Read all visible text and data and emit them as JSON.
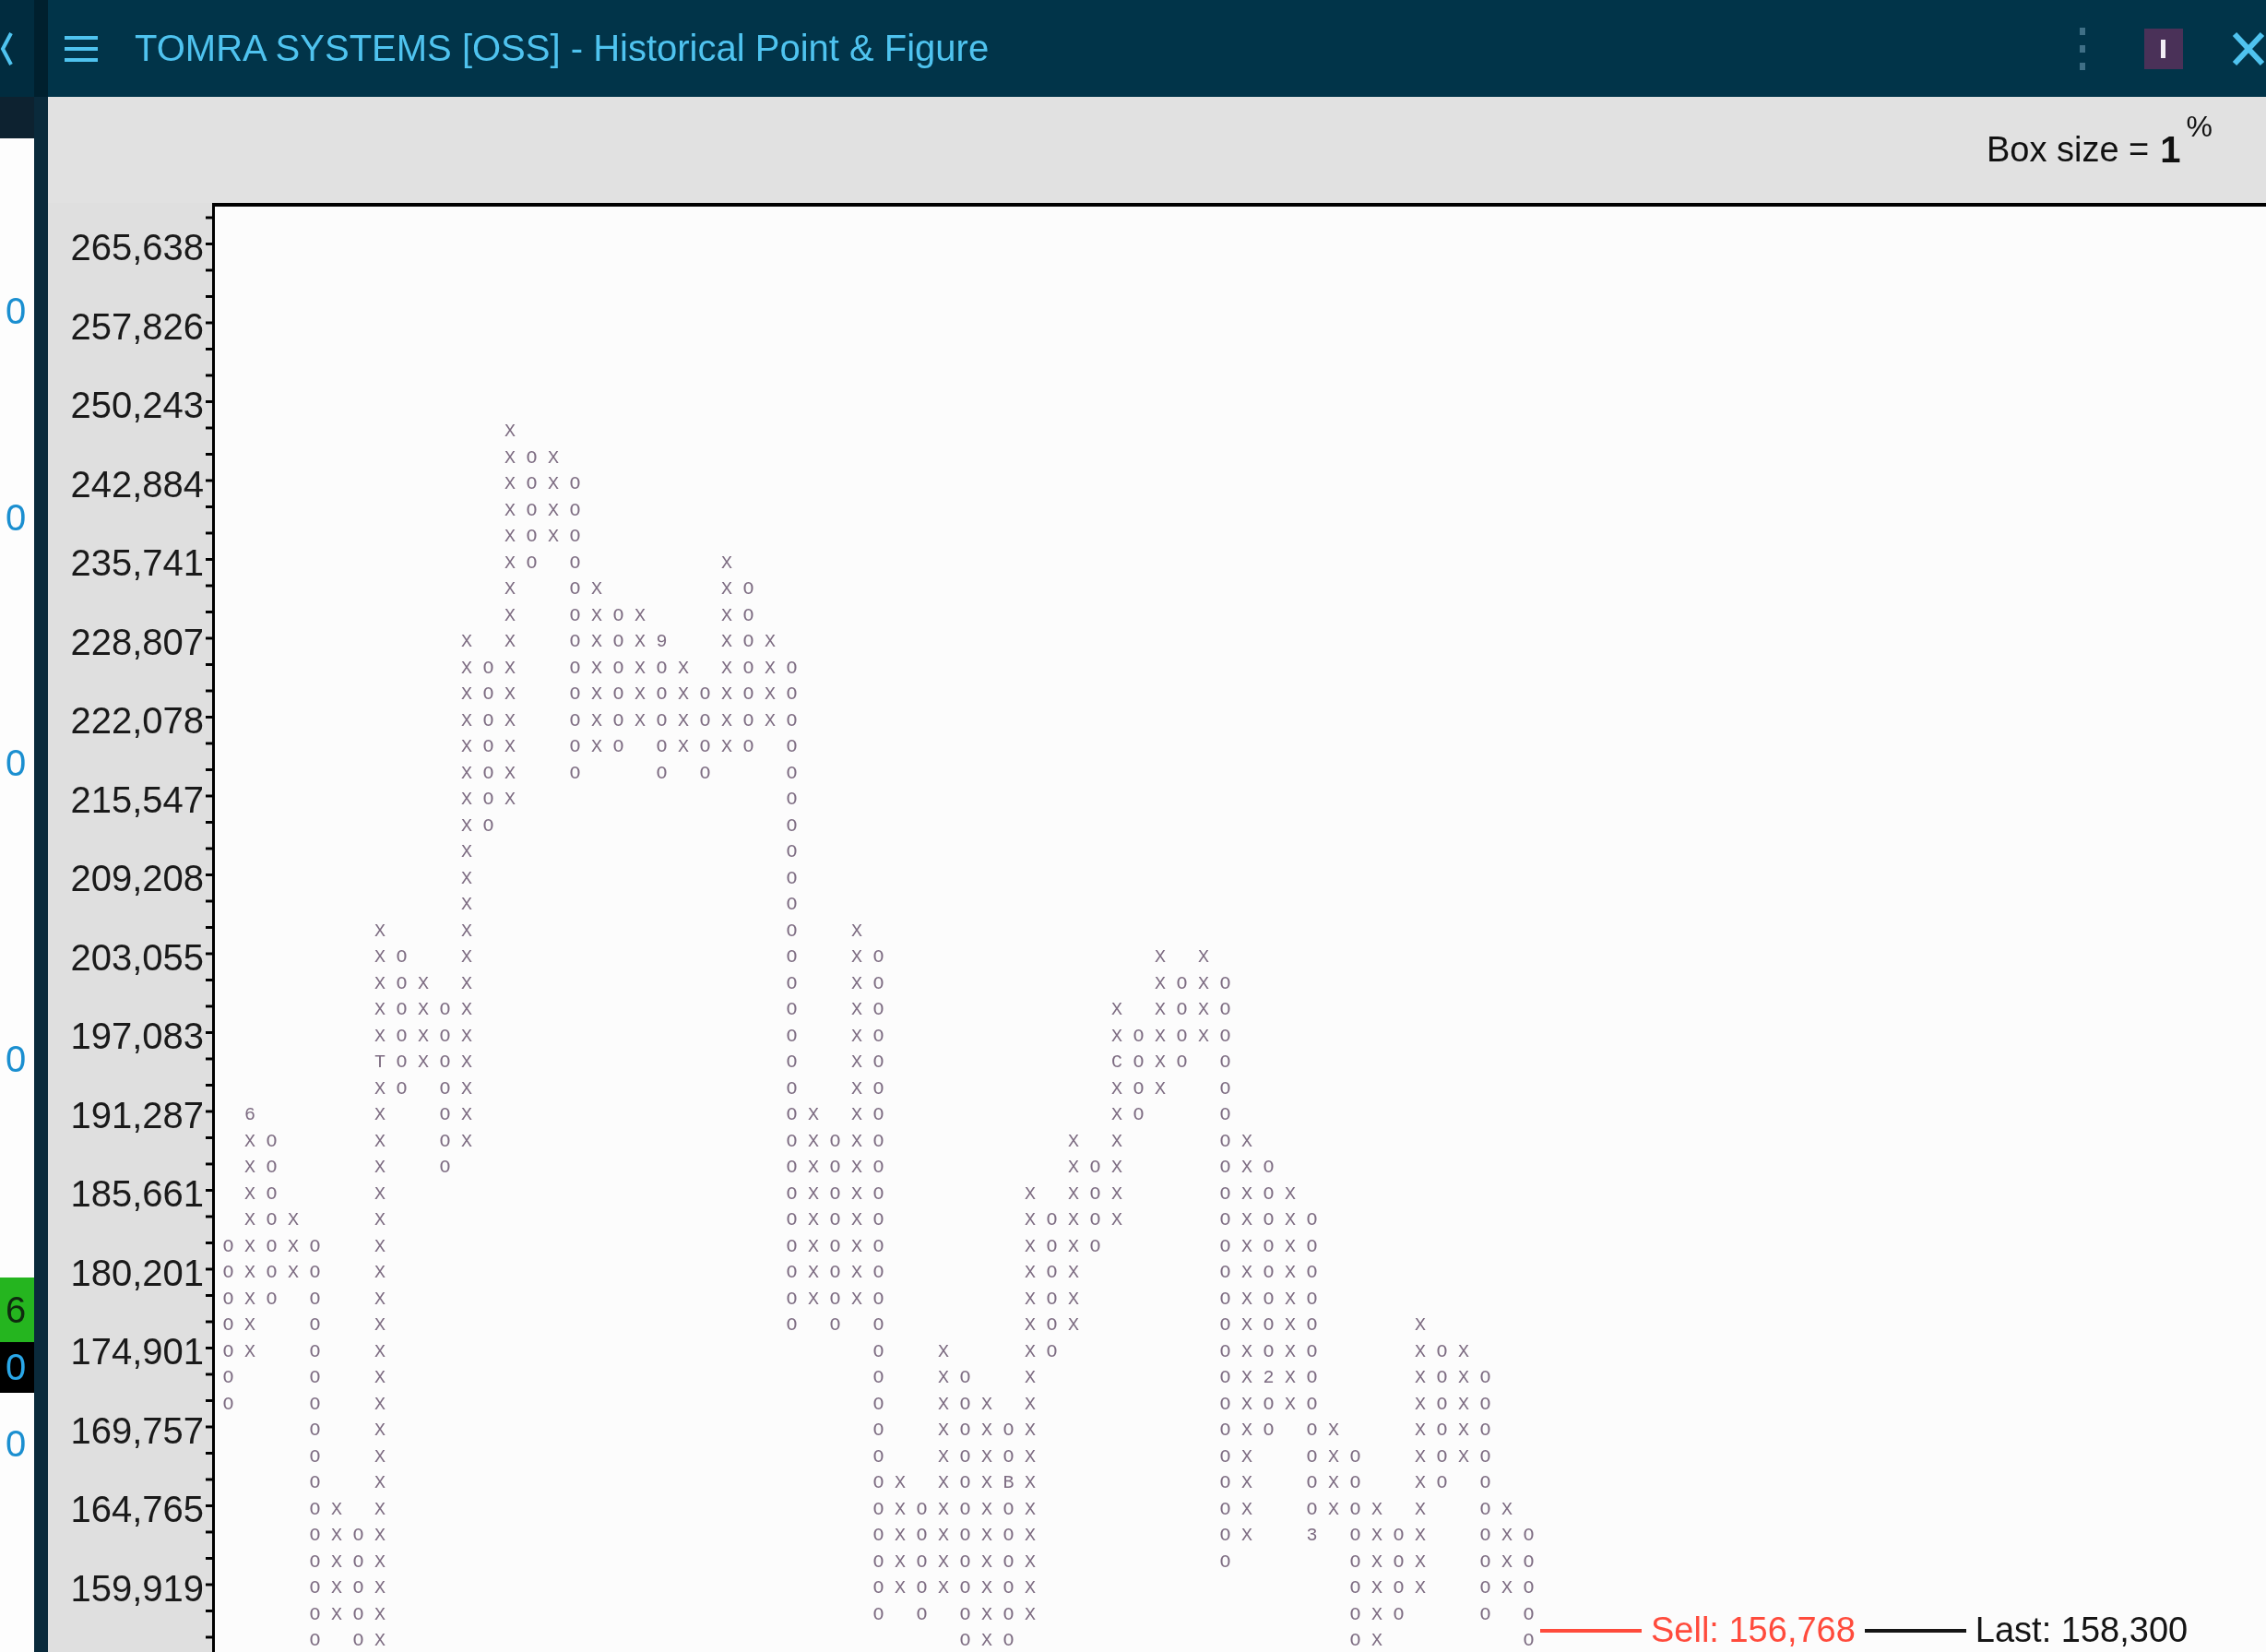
{
  "window": {
    "title": "TOMRA SYSTEMS [OSS] - Historical Point & Figure"
  },
  "side_panel": {
    "fragments": [
      {
        "kind": "plain",
        "text": "0"
      },
      {
        "kind": "plain",
        "text": "0"
      },
      {
        "kind": "plain",
        "text": "0"
      },
      {
        "kind": "plain",
        "text": "0"
      },
      {
        "kind": "green",
        "text": "6"
      },
      {
        "kind": "black",
        "text": "0"
      },
      {
        "kind": "plain",
        "text": "0"
      }
    ]
  },
  "header": {
    "box_size_label": "Box size =",
    "box_size_value": "1",
    "box_size_unit": "%"
  },
  "chart": {
    "y_axis_labels": [
      "265,638",
      "257,826",
      "250,243",
      "242,884",
      "235,741",
      "228,807",
      "222,078",
      "215,547",
      "209,208",
      "203,055",
      "197,083",
      "191,287",
      "185,661",
      "180,201",
      "174,901",
      "169,757",
      "164,765",
      "159,919"
    ],
    "rows": [
      "             X",
      "             XOX",
      "             XOXO",
      "             XOXO",
      "             XOXO",
      "             XO O      X",
      "             X  OX     XO",
      "             X  OXOX   XO",
      "           X X  OXOX9  XOX",
      "           XOX  OXOXOX XOXO",
      "           XOX  OXOXOXOXOXO",
      "           XOX  OXOXOXOXOXO",
      "           XOX  OXO OXOXO O",
      "           XOX  O   O O   O",
      "           XOX            O",
      "           XO             O",
      "           X              O",
      "           X              O",
      "           X              O",
      "       X   X              O  X",
      "       XO  X              O  XO            X X",
      "       XOX X              O  XO            XOXO",
      "       XOXOX              O  XO          X XOXO",
      "       XOXOX              O  XO          XOXOXO",
      "       TOXOX              O  XO          COXO O",
      "       XO OX              O  XO          XOX  O",
      " 6     X  OX              OX XO          XO   O",
      " XO    X  OX              OXOXO        X X    OX",
      " XO    X  O               OXOXO        XOX    OXO",
      " XO    X                  OXOXO      X XOX    OXOX",
      " XOX   X                  OXOXO      XOXOX    OXOXO",
      "OXOXO  X                  OXOXO      XOXO     OXOXO",
      "OXOXO  X                  OXOXO      XOX      OXOXO",
      "OXO O  X                  OXOXO      XOX      OXOXO",
      "OX  O  X                  O O O      XOX      OXOXO    X",
      "OX  O  X                      O  X   XO       OXOXO    XOX",
      "O   O  X                      O  XO  X        OX2XO    XOXO",
      "O   O  X                      O  XOX X        OXOXO    XOXO",
      "    O  X                      O  XOXOX        OXO OX   XOXO",
      "    O  X                      O  XOXOX        OX  OXO  XOXO",
      "    O  X                      OX XOXBX        OX  OXO  XO O",
      "    OX X                      OXOXOXOX        OX  OXOX X  OX",
      "    OXOX                      OXOXOXOX        OX  3 OXOX  OXO",
      "    OXOX                      OXOXOXOX        O     OXOX  OXO",
      "    OXOX                      OXOXOXOX              OXOX  OXO",
      "    OXOX                      O O OXOX              OXO   O O",
      "    O OX                          OXO               OX      O"
    ],
    "price_lines": [
      {
        "kind": "sell",
        "label": "Sell: 156,768"
      },
      {
        "kind": "last",
        "label": "Last: 158,300"
      }
    ]
  }
}
